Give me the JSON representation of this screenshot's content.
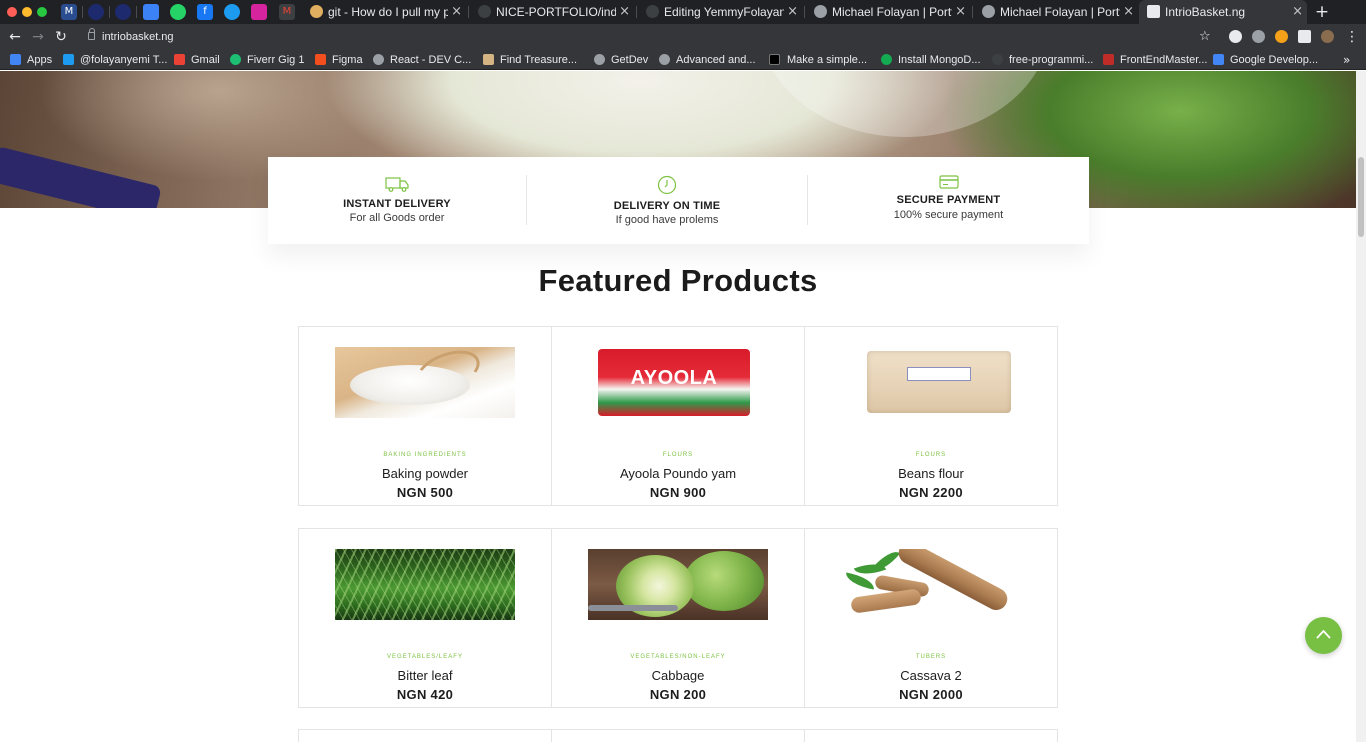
{
  "browser": {
    "tabs": [
      {
        "title": "git - How do I pull my pro"
      },
      {
        "title": "NICE-PORTFOLIO/index"
      },
      {
        "title": "Editing YemmyFolayan/R"
      },
      {
        "title": "Michael Folayan | Portfoli"
      },
      {
        "title": "Michael Folayan | Portfoli"
      },
      {
        "title": "IntrioBasket.ng"
      }
    ],
    "close_glyph": "×",
    "new_tab_glyph": "+",
    "url": "intriobasket.ng",
    "bookmarks": [
      {
        "label": "Apps"
      },
      {
        "label": "@folayanyemi T..."
      },
      {
        "label": "Gmail"
      },
      {
        "label": "Fiverr Gig 1"
      },
      {
        "label": "Figma"
      },
      {
        "label": "React - DEV C..."
      },
      {
        "label": "Find Treasure..."
      },
      {
        "label": "GetDev"
      },
      {
        "label": "Advanced and..."
      },
      {
        "label": "Make a simple..."
      },
      {
        "label": "Install MongoD..."
      },
      {
        "label": "free-programmi..."
      },
      {
        "label": "FrontEndMaster..."
      },
      {
        "label": "Google Develop..."
      }
    ],
    "bookmarks_more": "»"
  },
  "features": [
    {
      "title": "INSTANT DELIVERY",
      "subtitle": "For all Goods order",
      "icon": "delivery-truck-icon"
    },
    {
      "title": "DELIVERY ON TIME",
      "subtitle": "If good have prolems",
      "icon": "clock-icon"
    },
    {
      "title": "SECURE PAYMENT",
      "subtitle": "100% secure payment",
      "icon": "credit-card-icon"
    }
  ],
  "section_title": "Featured Products",
  "products": [
    {
      "category": "Baking ingredients",
      "name": "Baking powder",
      "price": "NGN 500",
      "image": "baking-powder"
    },
    {
      "category": "Flours",
      "name": "Ayoola Poundo yam",
      "price": "NGN 900",
      "image": "poundo-yam-bag",
      "package_text": "AYOOLA"
    },
    {
      "category": "Flours",
      "name": "Beans flour",
      "price": "NGN 2200",
      "image": "beans-flour-bag"
    },
    {
      "category": "Vegetables/Leafy",
      "name": "Bitter leaf",
      "price": "NGN 420",
      "image": "bitter-leaf"
    },
    {
      "category": "Vegetables/Non-Leafy",
      "name": "Cabbage",
      "price": "NGN 200",
      "image": "cabbage"
    },
    {
      "category": "Tubers",
      "name": "Cassava 2",
      "price": "NGN 2000",
      "image": "cassava"
    }
  ],
  "colors": {
    "accent": "#7cc242",
    "to_top_button": "#77c043"
  }
}
